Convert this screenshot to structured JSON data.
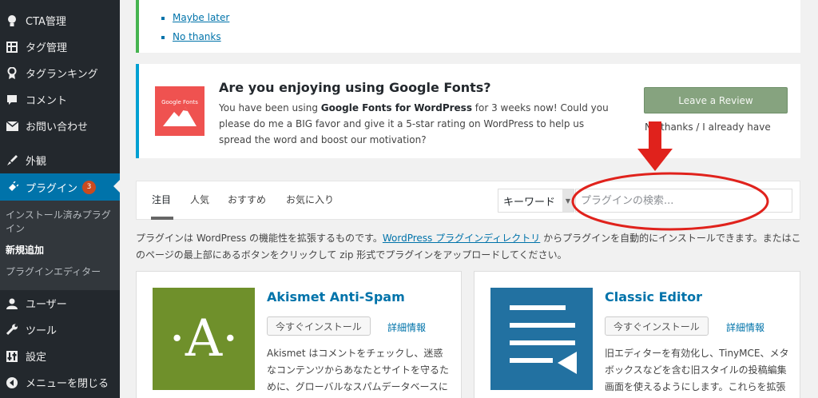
{
  "sidebar": {
    "items": [
      {
        "label": "CTA管理",
        "icon": "lightbulb-icon"
      },
      {
        "label": "タグ管理",
        "icon": "table-icon"
      },
      {
        "label": "タグランキング",
        "icon": "award-icon"
      },
      {
        "label": "コメント",
        "icon": "comment-icon"
      },
      {
        "label": "お問い合わせ",
        "icon": "mail-icon"
      },
      {
        "label": "外観",
        "icon": "paintbrush-icon"
      },
      {
        "label": "プラグイン",
        "icon": "plugin-icon",
        "badge": "3"
      },
      {
        "label": "ユーザー",
        "icon": "user-icon"
      },
      {
        "label": "ツール",
        "icon": "wrench-icon"
      },
      {
        "label": "設定",
        "icon": "settings-icon"
      },
      {
        "label": "メニューを閉じる",
        "icon": "collapse-icon"
      }
    ],
    "submenu": [
      "インストール済みプラグイン",
      "新規追加",
      "プラグインエディター"
    ]
  },
  "notice_top": {
    "links": [
      "Maybe later",
      "No thanks"
    ]
  },
  "notice_gf": {
    "logo_text": "Google Fonts",
    "title": "Are you enjoying using Google Fonts?",
    "body_pre": "You have been using ",
    "body_bold": "Google Fonts for WordPress",
    "body_post": " for 3 weeks now! Could you please do me a BIG favor and give it a 5-star rating on WordPress to help us spread the word and boost our motivation?",
    "review_button": "Leave a Review",
    "no_thanks": "No thanks / I already have"
  },
  "filter": {
    "tabs": [
      "注目",
      "人気",
      "おすすめ",
      "お気に入り"
    ],
    "select_value": "キーワード",
    "search_placeholder": "プラグインの検索..."
  },
  "description": {
    "pre": "プラグインは WordPress の機能性を拡張するものです。",
    "link": "WordPress プラグインディレクトリ",
    "post": " からプラグインを自動的にインストールできます。またはこのページの最上部にあるボタンをクリックして zip 形式でプラグインをアップロードしてください。"
  },
  "plugins": [
    {
      "name": "Akismet Anti-Spam",
      "install": "今すぐインストール",
      "details": "詳細情報",
      "icon_letter": "·A·",
      "description": "Akismet はコメントをチェックし、迷惑なコンテンツからあなたとサイトを守るために、グローバルなスパムデータベースに対して問合せフォームに連絡しま"
    },
    {
      "name": "Classic Editor",
      "install": "今すぐインストール",
      "details": "詳細情報",
      "description": "旧エディターを有効化し、TinyMCE、メタボックスなどを含む旧スタイルの投稿編集画面を使えるようにします。これらを拡張するすべてのプラグインに対応し"
    }
  ],
  "colors": {
    "sidebar_bg": "#23282d",
    "active_menu": "#0073aa",
    "link": "#0073aa",
    "akismet_green": "#6f902b",
    "classic_blue": "#2271a1",
    "annotation_red": "#e0221c"
  }
}
